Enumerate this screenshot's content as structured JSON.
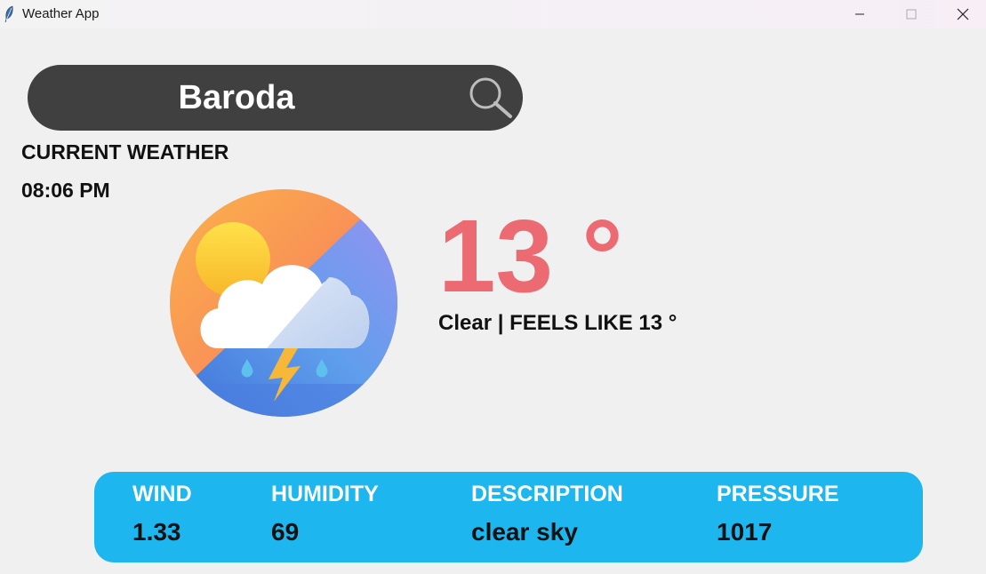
{
  "window": {
    "title": "Weather App"
  },
  "search": {
    "city": "Baroda",
    "search_icon": "search-icon"
  },
  "weather": {
    "section_label": "CURRENT WEATHER",
    "time": "08:06 PM",
    "temperature": "13 °",
    "summary": "Clear | FEELS LIKE 13 °",
    "logo_icon": "weather-logo-icon"
  },
  "details": {
    "wind": {
      "label": "WIND",
      "value": "1.33"
    },
    "humidity": {
      "label": "HUMIDITY",
      "value": "69"
    },
    "description": {
      "label": "DESCRIPTION",
      "value": "clear sky"
    },
    "pressure": {
      "label": "PRESSURE",
      "value": "1017"
    }
  },
  "colors": {
    "search_bar": "#404040",
    "temperature": "#ec6a72",
    "info_panel": "#1db6ee"
  }
}
